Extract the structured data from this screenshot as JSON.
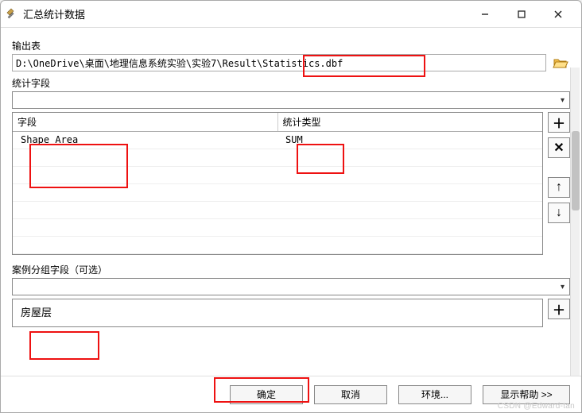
{
  "window": {
    "title": "汇总统计数据"
  },
  "output": {
    "label": "输出表",
    "path": "D:\\OneDrive\\桌面\\地理信息系统实验\\实验7\\Result\\Statistics.dbf"
  },
  "stat_field": {
    "label": "统计字段",
    "selected": ""
  },
  "grid": {
    "headers": {
      "field": "字段",
      "stat_type": "统计类型"
    },
    "rows": [
      {
        "field": "Shape_Area",
        "stat_type": "SUM"
      }
    ]
  },
  "case_field": {
    "label": "案例分组字段（可选）",
    "selected": "",
    "items": [
      "房屋层"
    ]
  },
  "buttons": {
    "ok": "确定",
    "cancel": "取消",
    "env": "环境...",
    "help": "显示帮助 >>"
  },
  "watermark": "CSDN @Edward-tan"
}
